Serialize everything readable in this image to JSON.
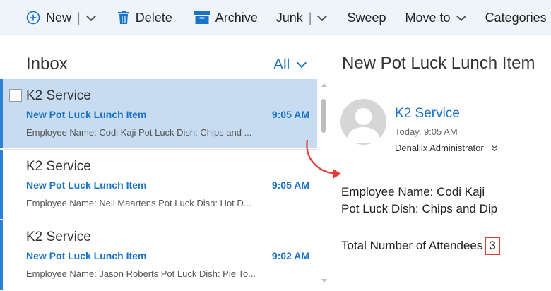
{
  "toolbar": {
    "new_label": "New",
    "delete_label": "Delete",
    "archive_label": "Archive",
    "junk_label": "Junk",
    "sweep_label": "Sweep",
    "move_label": "Move to",
    "categories_label": "Categories"
  },
  "list": {
    "title": "Inbox",
    "filter": "All",
    "items": [
      {
        "sender": "K2 Service",
        "subject": "New Pot Luck Lunch Item",
        "time": "9:05 AM",
        "preview": "Employee Name: Codi Kaji Pot Luck Dish: Chips and ...",
        "selected": true
      },
      {
        "sender": "K2 Service",
        "subject": "New Pot Luck Lunch Item",
        "time": "9:05 AM",
        "preview": "Employee Name: Neil Maartens Pot Luck Dish: Hot D...",
        "selected": false
      },
      {
        "sender": "K2 Service",
        "subject": "New Pot Luck Lunch Item",
        "time": "9:02 AM",
        "preview": "Employee Name: Jason Roberts Pot Luck Dish: Pie  To...",
        "selected": false
      }
    ]
  },
  "reading": {
    "subject": "New Pot Luck Lunch Item",
    "sender": "K2 Service",
    "date": "Today, 9:05 AM",
    "to": "Denallix Administrator",
    "body_line1": "Employee Name: Codi Kaji",
    "body_line2": "Pot Luck Dish: Chips and Dip",
    "total_label": "Total Number of Attendees",
    "total_value": "3"
  },
  "colors": {
    "accent": "#1a73c7",
    "selected_bg": "#c7dcf1",
    "toolbar_bg": "#eff4fa",
    "highlight": "#e53935"
  },
  "icons": [
    "plus-circle-icon",
    "trash-icon",
    "archive-icon",
    "chevron-down-icon",
    "avatar-icon",
    "double-chevron-icon",
    "annotation-arrow"
  ]
}
